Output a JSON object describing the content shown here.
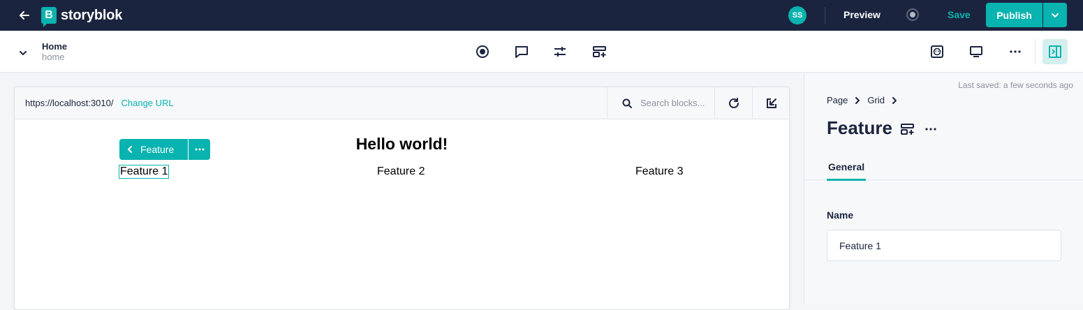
{
  "topbar": {
    "logo_letter": "B",
    "logo_text": "storyblok",
    "avatar_initials": "SS",
    "preview_label": "Preview",
    "save_label": "Save",
    "publish_label": "Publish",
    "accent": "#09b3af",
    "bg": "#1b243f"
  },
  "subbar": {
    "title": "Home",
    "slug": "home",
    "icons": [
      "record-icon",
      "comment-icon",
      "sliders-icon",
      "add-block-icon",
      "face-icon",
      "desktop-icon",
      "more-icon",
      "sidebar-toggle-icon"
    ]
  },
  "preview": {
    "url": "https://localhost:3010/",
    "change_url_label": "Change URL",
    "search_placeholder": "Search blocks...",
    "heading": "Hello world!",
    "block_label": "Feature",
    "features": [
      "Feature 1",
      "Feature 2",
      "Feature 3"
    ]
  },
  "sidepanel": {
    "last_saved": "Last saved: a few seconds ago",
    "breadcrumbs": [
      "Page",
      "Grid"
    ],
    "title": "Feature",
    "tab_general": "General",
    "field_label": "Name",
    "field_value": "Feature 1"
  }
}
